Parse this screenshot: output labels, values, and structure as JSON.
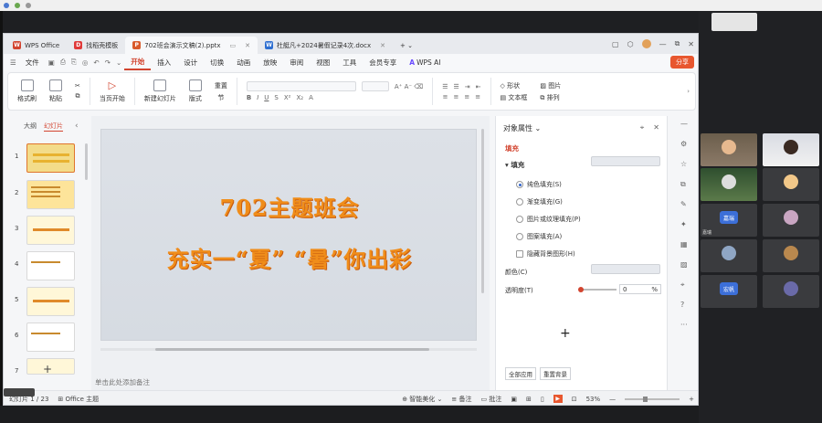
{
  "wps": {
    "tabs": [
      {
        "label": "WPS Office"
      },
      {
        "label": "找稻壳模板"
      },
      {
        "label": "702班会演示文稿(2).pptx"
      },
      {
        "label": "杜艇凡+2024暑假记录4次.docx"
      }
    ],
    "menu": [
      "文件",
      "开始",
      "插入",
      "设计",
      "切换",
      "动画",
      "放映",
      "审阅",
      "视图",
      "工具",
      "会员专享"
    ],
    "menu_active": "开始",
    "wps_ai": "WPS AI",
    "share": "分享",
    "ribbon": {
      "format_brush": "格式刷",
      "paste": "粘贴",
      "play_from_current": "当页开始",
      "new_slide": "新建幻灯片",
      "layout": "版式",
      "section": "节",
      "redraw": "重置",
      "shape": "形状",
      "picture": "图片",
      "textbox": "文本框",
      "arrange": "排列"
    }
  },
  "left_panel": {
    "tab_outline": "大纲",
    "tab_slides": "幻灯片",
    "slide_numbers": [
      "1",
      "2",
      "3",
      "4",
      "5",
      "6",
      "7"
    ]
  },
  "slide": {
    "title": "702主题班会",
    "subtitle": "充实一“夏”   “暑”你出彩"
  },
  "notes_placeholder": "单击此处添加备注",
  "props": {
    "header": "对象属性",
    "fill_tab": "填充",
    "fill_section": "填充",
    "options": [
      "纯色填充(S)",
      "渐变填充(G)",
      "图片或纹理填充(P)",
      "图案填充(A)"
    ],
    "selected_option": "纯色填充(S)",
    "hide_bg": "隐藏背景图形(H)",
    "color_label": "颜色(C)",
    "transparency_label": "透明度(T)",
    "transparency_value": "0",
    "transparency_unit": "%",
    "apply_all": "全部应用",
    "reset_bg": "重置背景"
  },
  "status": {
    "slide_pos": "幻灯片 1 / 23",
    "theme": "Office 主题",
    "beautify": "智能美化",
    "notes": "备注",
    "comment": "批注",
    "zoom": "53%"
  },
  "meeting": {
    "participants": [
      "",
      "",
      "",
      "",
      "",
      "嘉瑞",
      "",
      "",
      "",
      "",
      "宏帆",
      ""
    ],
    "name_tiles": [
      "嘉瑞",
      "宏帆"
    ]
  },
  "colors": {
    "accent": "#d2442f",
    "slide_text": "#f08d1a",
    "share_btn": "#e8572f"
  }
}
